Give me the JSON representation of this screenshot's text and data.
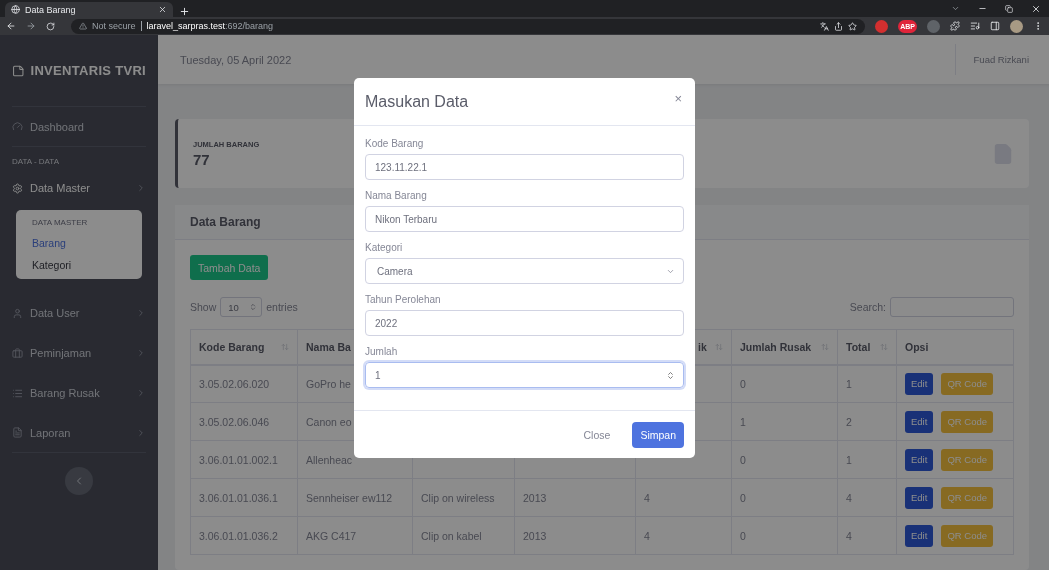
{
  "browser": {
    "tab_title": "Data Barang",
    "security": "Not secure",
    "url_host": "laravel_sarpras.test",
    "url_rest": ":692/barang",
    "extension_label": "ABP"
  },
  "sidebar": {
    "brand": "INVENTARIS TVRI",
    "items": [
      {
        "kind": "link",
        "label": "Dashboard"
      },
      {
        "kind": "heading",
        "label": "DATA - DATA"
      },
      {
        "kind": "menu",
        "label": "Data Master",
        "expanded": true,
        "group_title": "DATA MASTER",
        "children": [
          {
            "label": "Barang",
            "selected": true
          },
          {
            "label": "Kategori",
            "selected": false
          }
        ]
      },
      {
        "kind": "menu",
        "label": "Data User",
        "expanded": false
      },
      {
        "kind": "menu",
        "label": "Peminjaman",
        "expanded": false
      },
      {
        "kind": "menu",
        "label": "Barang Rusak",
        "expanded": false
      },
      {
        "kind": "menu",
        "label": "Laporan",
        "expanded": false
      }
    ]
  },
  "topbar": {
    "date": "Tuesday, 05 April 2022",
    "user": "Fuad Rizkani"
  },
  "stat_card": {
    "label": "JUMLAH BARANG",
    "value": "77"
  },
  "data_card": {
    "title": "Data Barang",
    "add_button": "Tambah Data",
    "length_prefix": "Show",
    "length_value": "10",
    "length_suffix": "entries",
    "search_label": "Search:"
  },
  "table": {
    "columns": [
      {
        "label": "Kode Barang",
        "sortable": true
      },
      {
        "label": "Nama Ba"
      },
      {},
      {},
      {
        "label": "ik",
        "sortable": true
      },
      {
        "label": "Jumlah Rusak",
        "sortable": true
      },
      {
        "label": "Total",
        "sortable": true
      },
      {
        "label": "Opsi",
        "sortable": false
      }
    ],
    "rows": [
      {
        "cells": [
          "3.05.02.06.020",
          "GoPro he",
          null,
          null,
          null,
          "0",
          "1"
        ],
        "actions": [
          "Edit",
          "QR Code"
        ]
      },
      {
        "cells": [
          "3.05.02.06.046",
          "Canon eo",
          null,
          null,
          null,
          "1",
          "2"
        ],
        "actions": [
          "Edit",
          "QR Code"
        ]
      },
      {
        "cells": [
          "3.06.01.01.002.1",
          "Allenheac",
          null,
          null,
          null,
          "0",
          "1"
        ],
        "actions": [
          "Edit",
          "QR Code"
        ]
      },
      {
        "cells": [
          "3.06.01.01.036.1",
          "Sennheiser ew112",
          "Clip on wireless",
          "2013",
          "4",
          "0",
          "4"
        ],
        "actions": [
          "Edit",
          "QR Code"
        ]
      },
      {
        "cells": [
          "3.06.01.01.036.2",
          "AKG C417",
          "Clip on kabel",
          "2013",
          "4",
          "0",
          "4"
        ],
        "actions": [
          "Edit",
          "QR Code"
        ]
      }
    ]
  },
  "modal": {
    "title": "Masukan Data",
    "close_glyph": "×",
    "fields": [
      {
        "kind": "text",
        "label": "Kode Barang",
        "value": "123.11.22.1",
        "focused": false
      },
      {
        "kind": "text",
        "label": "Nama Barang",
        "value": "Nikon Terbaru",
        "focused": false
      },
      {
        "kind": "select",
        "label": "Kategori",
        "value": "Camera",
        "focused": false
      },
      {
        "kind": "text",
        "label": "Tahun Perolehan",
        "value": "2022",
        "focused": false
      },
      {
        "kind": "number",
        "label": "Jumlah",
        "value": "1",
        "focused": true
      }
    ],
    "buttons": [
      {
        "kind": "secondary",
        "label": "Close"
      },
      {
        "kind": "primary",
        "label": "Simpan"
      }
    ]
  }
}
